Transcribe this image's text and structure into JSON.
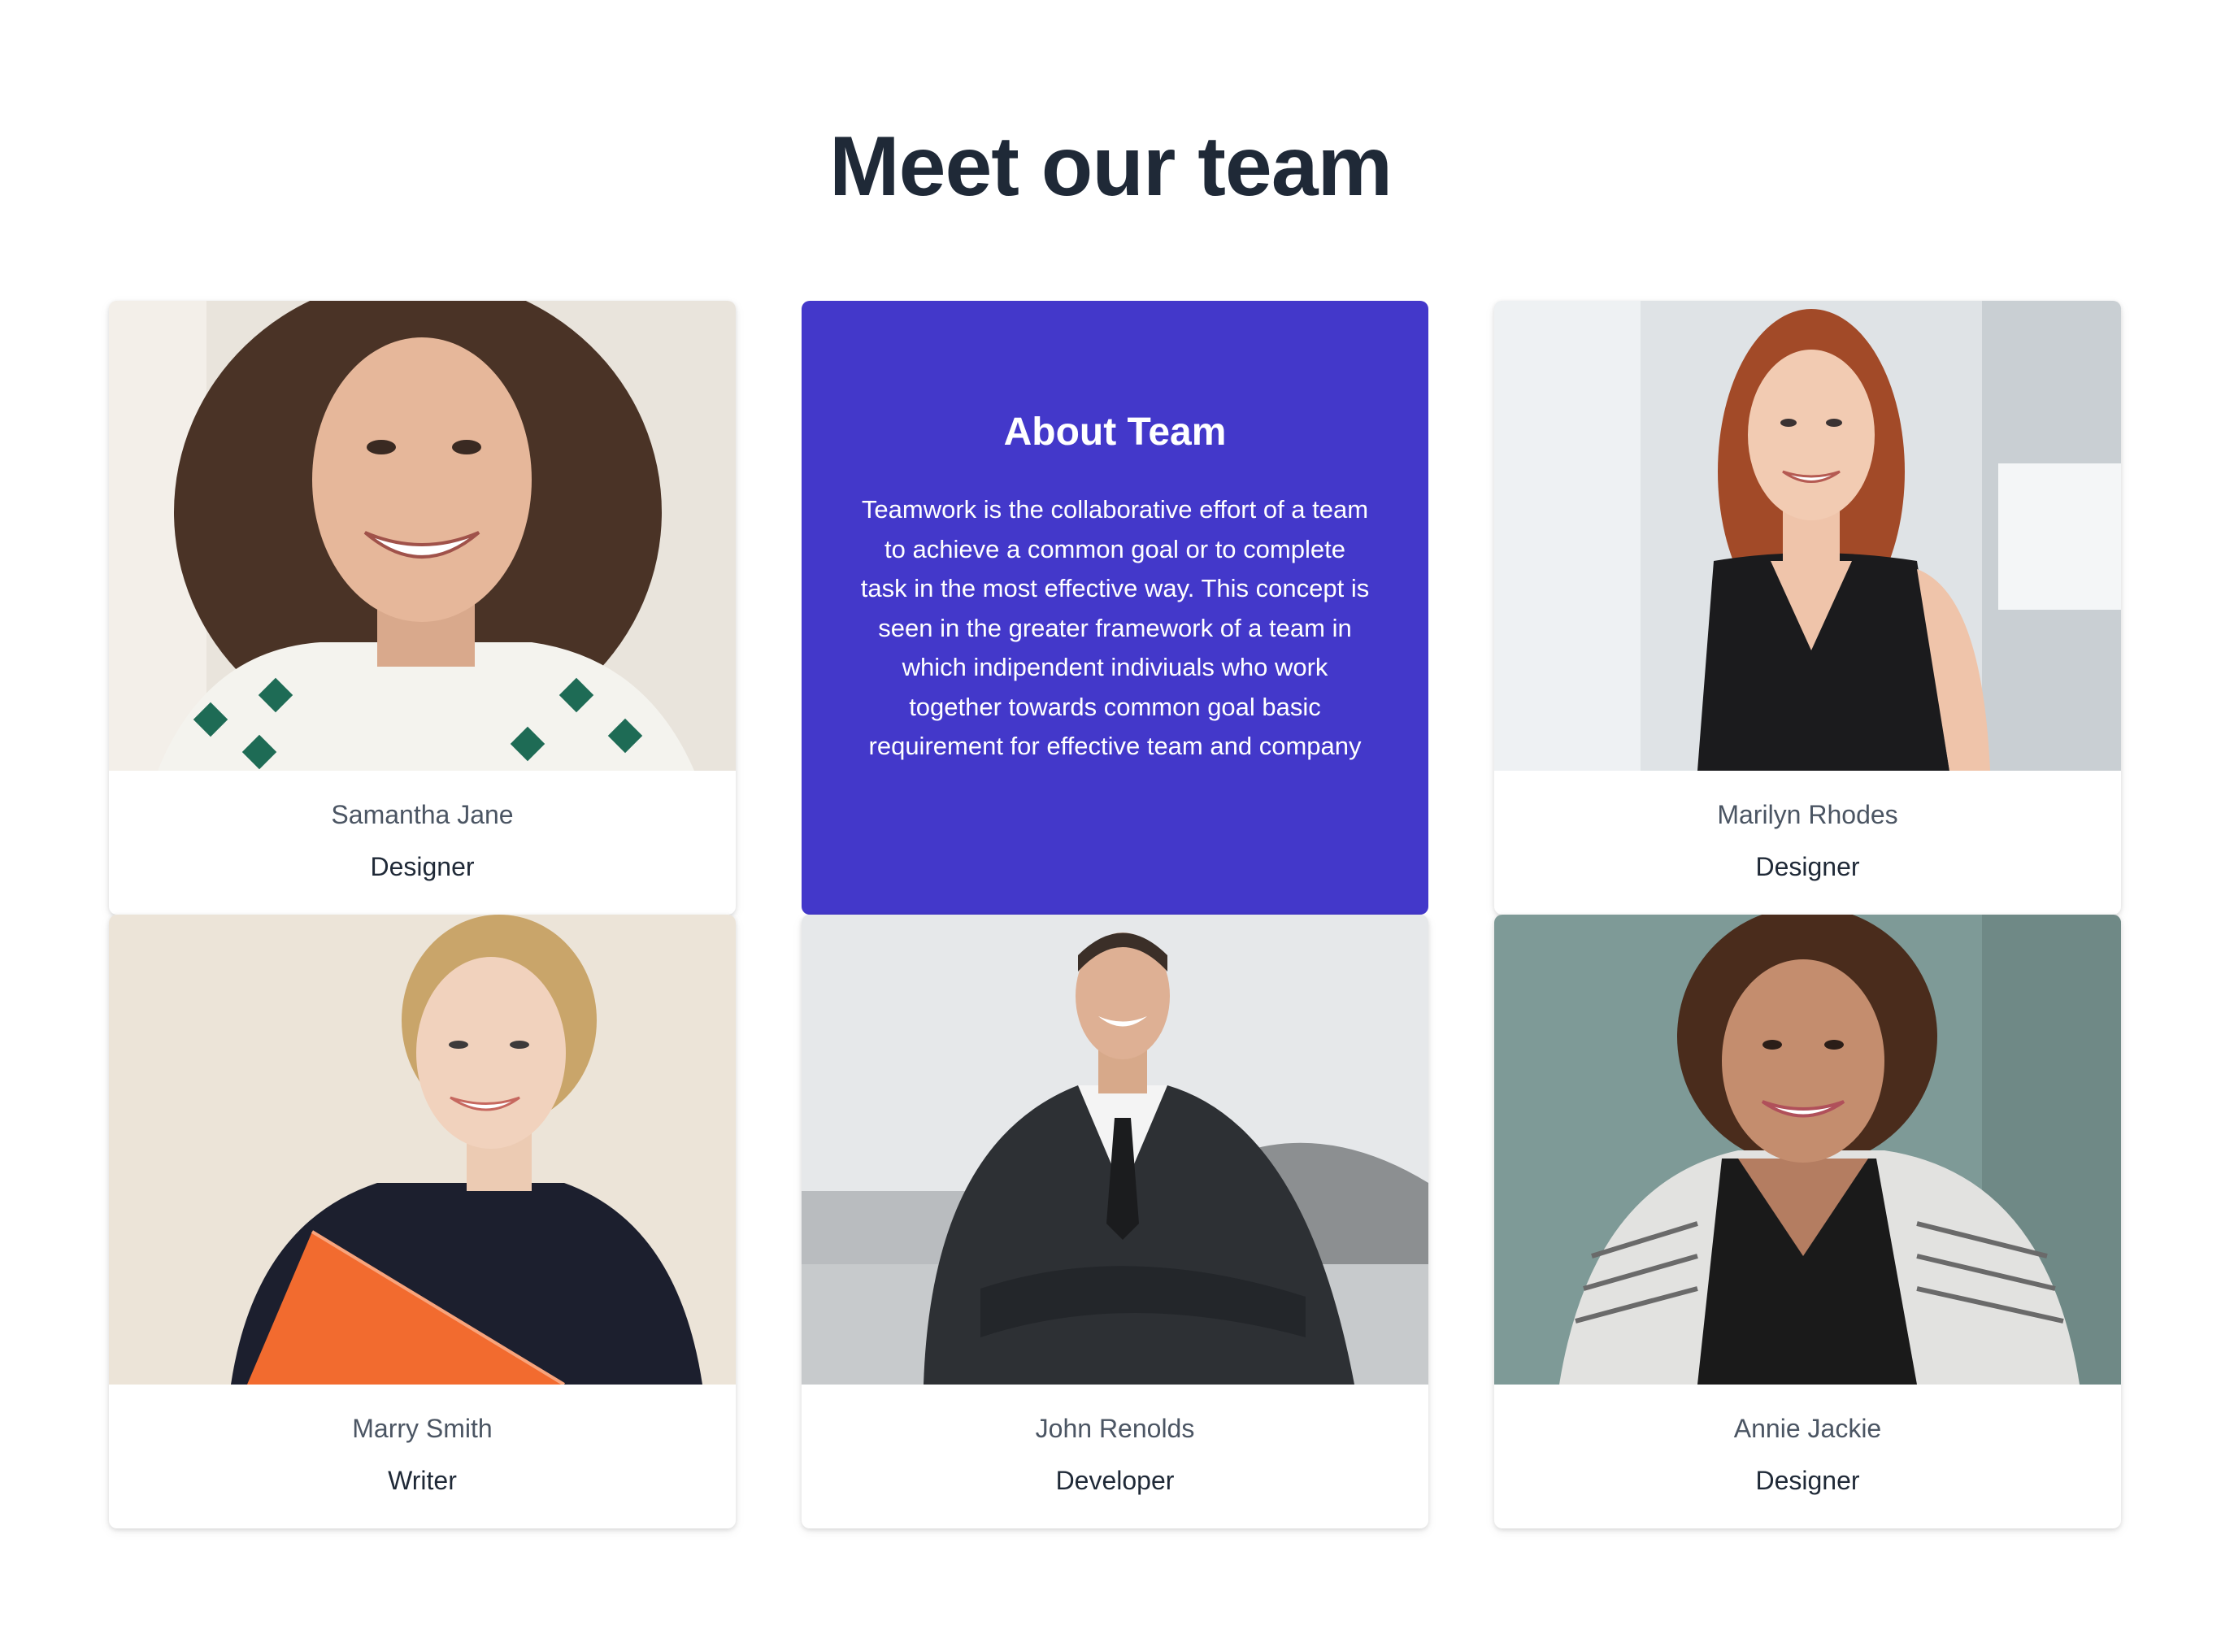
{
  "page": {
    "title": "Meet our team"
  },
  "about": {
    "heading": "About Team",
    "body": "Teamwork is the collaborative effort of a team to achieve a common goal or to complete task in the most effective way. This concept is seen in the greater framework of a team in which indipendent indiviuals who work together towards common goal basic requirement for effective team and company",
    "background_color": "#4338ca"
  },
  "members": [
    {
      "name": "Samantha Jane",
      "role": "Designer"
    },
    {
      "name": "Marilyn Rhodes",
      "role": "Designer"
    },
    {
      "name": "Marry Smith",
      "role": "Writer"
    },
    {
      "name": "John Renolds",
      "role": "Developer"
    },
    {
      "name": "Annie Jackie",
      "role": "Designer"
    }
  ]
}
